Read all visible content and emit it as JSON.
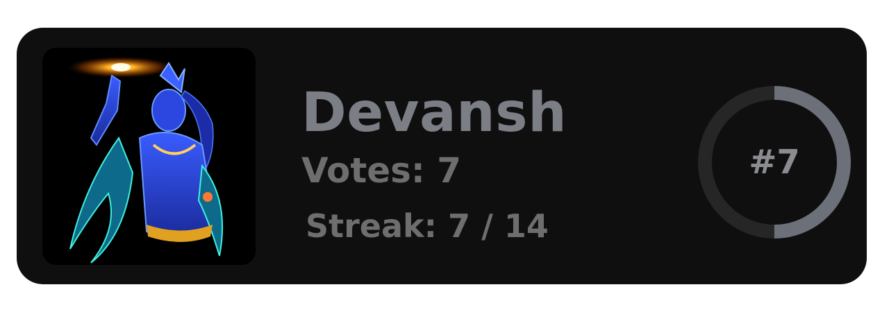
{
  "user": {
    "name": "Devansh",
    "votes_text": "Votes: 7",
    "streak_text": "Streak: 7 / 14",
    "streak_current": 7,
    "streak_total": 14
  },
  "rank": {
    "label": "#7",
    "progress_fraction": 0.5
  },
  "colors": {
    "card_bg": "#0f0f0f",
    "name": "#7b7e84",
    "secondary_text": "#6e6e6e",
    "ring_track": "#262626",
    "ring_fill": "#6c7079"
  }
}
